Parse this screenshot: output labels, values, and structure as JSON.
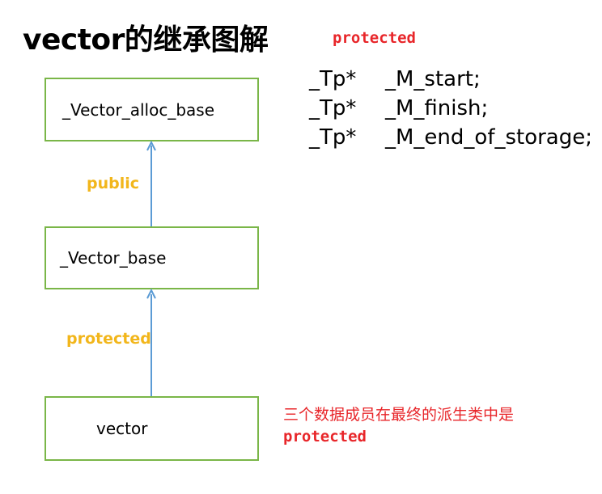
{
  "title": "vector的继承图解",
  "members": {
    "access": "protected",
    "fields": [
      {
        "type": "_Tp*",
        "name": "_M_start;"
      },
      {
        "type": "_Tp*",
        "name": "_M_finish;"
      },
      {
        "type": "_Tp*",
        "name": "_M_end_of_storage;"
      }
    ]
  },
  "classes": {
    "alloc_base": "_Vector_alloc_base",
    "base": "_Vector_base",
    "vector": "vector"
  },
  "inheritance": {
    "base_to_alloc_base": "public",
    "vector_to_base": "protected"
  },
  "note": {
    "text": "三个数据成员在最终的派生类中是",
    "code": "protected"
  },
  "colors": {
    "box_border": "#7ab648",
    "arrow": "#5b9bd5",
    "inheritance_label": "#f2b61b",
    "access_red": "#e8262a"
  }
}
